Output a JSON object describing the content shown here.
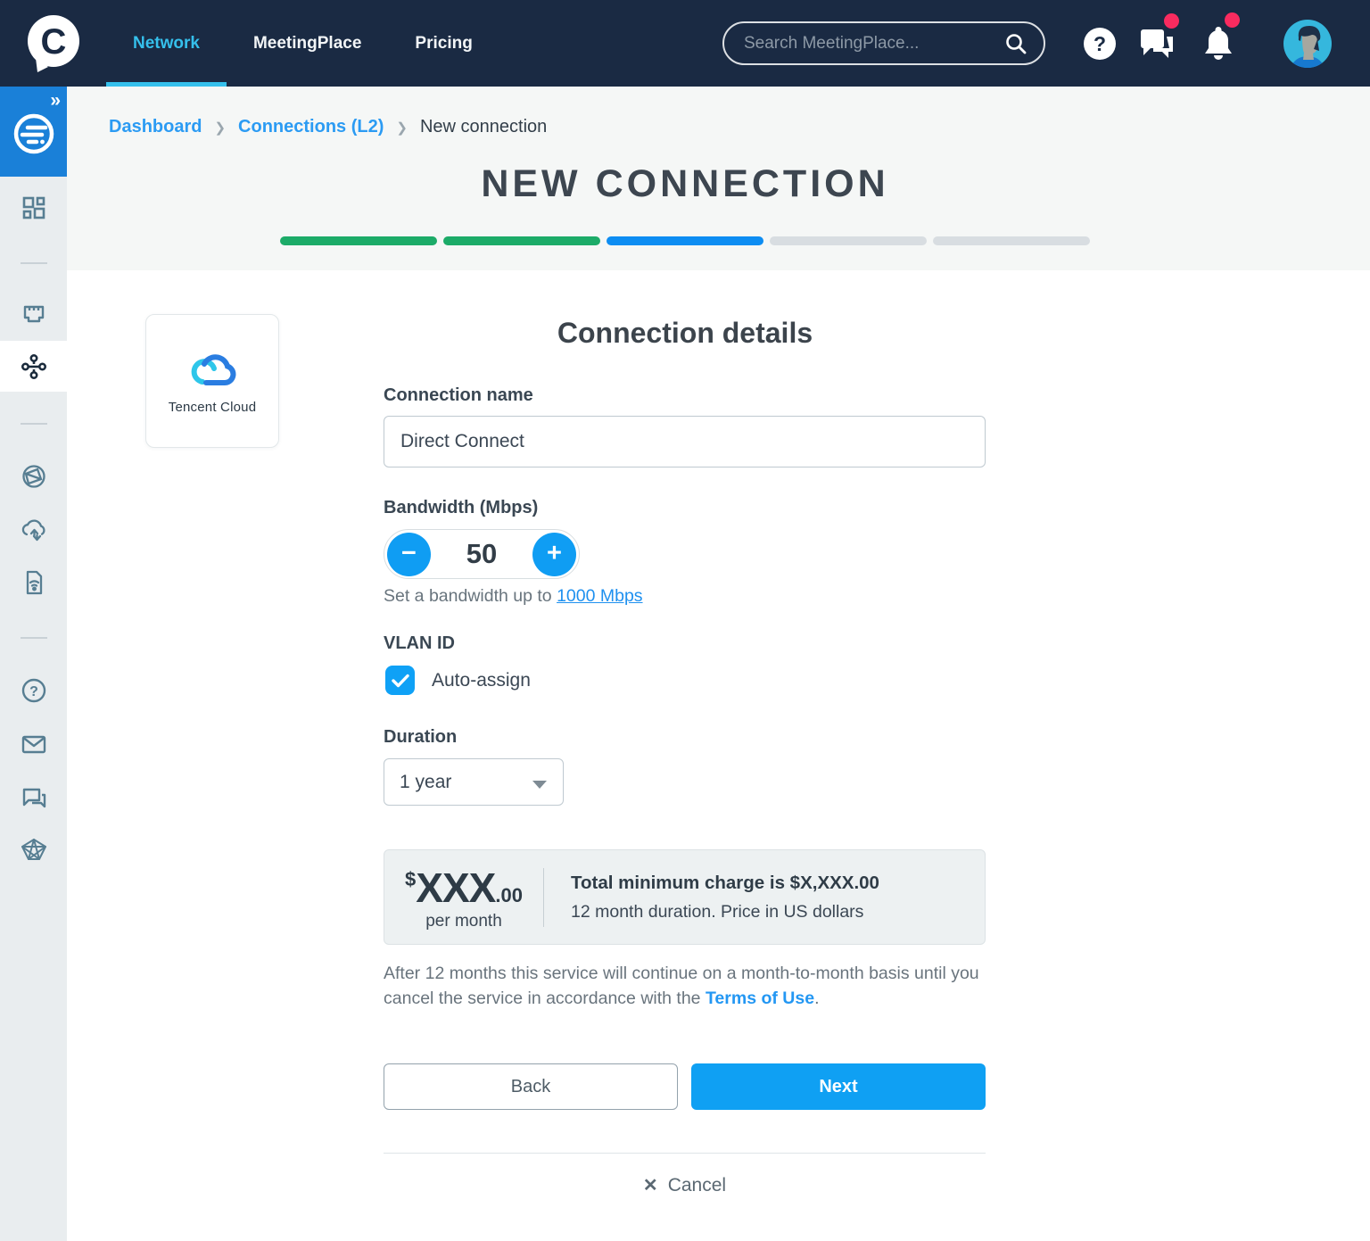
{
  "nav": {
    "items": [
      {
        "label": "Network",
        "active": true
      },
      {
        "label": "MeetingPlace",
        "active": false
      },
      {
        "label": "Pricing",
        "active": false
      }
    ],
    "search": {
      "placeholder": "Search MeetingPlace..."
    },
    "icons": [
      "search-icon",
      "help-icon",
      "messages-icon",
      "notifications-icon",
      "avatar"
    ],
    "badge_color": "#f92b5f",
    "accent_color": "#35c0ec"
  },
  "sidebar": {
    "icons": [
      "expand-icon",
      "network-logo-icon",
      "dashboard-icon",
      "ports-icon",
      "connections-icon",
      "internet-exchange-icon",
      "cloud-connect-icon",
      "iot-sim-icon",
      "help-icon",
      "mail-icon",
      "chat-icon",
      "referrals-icon"
    ],
    "active_item": "connections-icon",
    "accent_color": "#1a80d8"
  },
  "breadcrumb": {
    "items": [
      "Dashboard",
      "Connections (L2)",
      "New connection"
    ]
  },
  "page": {
    "title": "NEW CONNECTION"
  },
  "progress": {
    "states": [
      "done",
      "done",
      "current",
      "todo",
      "todo"
    ],
    "colors": {
      "done": "#1cab68",
      "current": "#0d8df2",
      "todo": "#d8dde1"
    }
  },
  "provider": {
    "name": "Tencent Cloud"
  },
  "form": {
    "heading": "Connection details",
    "connection_name": {
      "label": "Connection name",
      "value": "Direct Connect"
    },
    "bandwidth": {
      "label": "Bandwidth (Mbps)",
      "value": "50",
      "minus": "−",
      "plus": "+",
      "helper_prefix": "Set a bandwidth up to ",
      "helper_link": "1000 Mbps"
    },
    "vlan": {
      "label": "VLAN ID",
      "checkbox_label": "Auto-assign",
      "checked": true
    },
    "duration": {
      "label": "Duration",
      "value": "1 year"
    }
  },
  "pricing": {
    "currency": "$",
    "amount": "XXX",
    "decimals": ".00",
    "period": "per month",
    "total": "Total minimum charge is $X,XXX.00",
    "details": "12 month duration. Price in US dollars",
    "note": "After 12 months this service will continue on a month-to-month basis until you cancel the service in accordance with the ",
    "terms_link": "Terms of Use",
    "note_suffix": "."
  },
  "actions": {
    "back": "Back",
    "next": "Next",
    "cancel": "Cancel",
    "cancel_icon": "✕"
  }
}
